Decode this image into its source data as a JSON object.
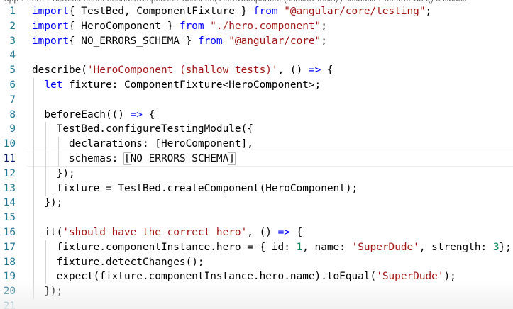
{
  "breadcrumb": {
    "items": [
      "app",
      "hero",
      "hero.component.shallow.spec.ts",
      "describe('HeroComponent (shallow tests)') callback",
      "beforeEach() callback"
    ]
  },
  "editor": {
    "lines": [
      {
        "n": "1",
        "tokens": [
          [
            "kw",
            "import"
          ],
          [
            "",
            "{ TestBed, ComponentFixture } "
          ],
          [
            "kw",
            "from"
          ],
          [
            "",
            " "
          ],
          [
            "str",
            "\"@angular/core/testing\""
          ],
          [
            "",
            ";"
          ]
        ]
      },
      {
        "n": "2",
        "tokens": [
          [
            "kw",
            "import"
          ],
          [
            "",
            "{ HeroComponent } "
          ],
          [
            "kw",
            "from"
          ],
          [
            "",
            " "
          ],
          [
            "str",
            "\"./hero.component\""
          ],
          [
            "",
            ";"
          ]
        ]
      },
      {
        "n": "3",
        "tokens": [
          [
            "kw",
            "import"
          ],
          [
            "",
            "{ NO_ERRORS_SCHEMA } "
          ],
          [
            "kw",
            "from"
          ],
          [
            "",
            " "
          ],
          [
            "str",
            "\"@angular/core\""
          ],
          [
            "",
            ";"
          ]
        ]
      },
      {
        "n": "4",
        "tokens": []
      },
      {
        "n": "5",
        "tokens": [
          [
            "",
            "describe("
          ],
          [
            "str",
            "'HeroComponent (shallow tests)'"
          ],
          [
            "",
            ", () "
          ],
          [
            "kw",
            "=>"
          ],
          [
            "",
            " {"
          ]
        ]
      },
      {
        "n": "6",
        "tokens": [
          [
            "",
            "  "
          ],
          [
            "kw",
            "let"
          ],
          [
            "",
            " fixture: ComponentFixture<HeroComponent>;"
          ]
        ]
      },
      {
        "n": "7",
        "tokens": []
      },
      {
        "n": "8",
        "tokens": [
          [
            "",
            "  beforeEach(() "
          ],
          [
            "kw",
            "=>"
          ],
          [
            "",
            " {"
          ]
        ]
      },
      {
        "n": "9",
        "tokens": [
          [
            "",
            "    TestBed.configureTestingModule({"
          ]
        ]
      },
      {
        "n": "10",
        "tokens": [
          [
            "",
            "      declarations: [HeroComponent],"
          ]
        ]
      },
      {
        "n": "11",
        "tokens": [
          [
            "",
            "      schemas: "
          ],
          [
            "bracket",
            "["
          ],
          [
            "",
            "NO_ERRORS_SCHEMA"
          ],
          [
            "bracket",
            "]"
          ]
        ],
        "current": true
      },
      {
        "n": "12",
        "tokens": [
          [
            "",
            "    });"
          ]
        ]
      },
      {
        "n": "13",
        "tokens": [
          [
            "",
            "    fixture = TestBed.createComponent(HeroComponent);"
          ]
        ]
      },
      {
        "n": "14",
        "tokens": [
          [
            "",
            "  });"
          ]
        ]
      },
      {
        "n": "15",
        "tokens": []
      },
      {
        "n": "16",
        "tokens": [
          [
            "",
            "  it("
          ],
          [
            "str",
            "'should have the correct hero'"
          ],
          [
            "",
            ", () "
          ],
          [
            "kw",
            "=>"
          ],
          [
            "",
            " {"
          ]
        ]
      },
      {
        "n": "17",
        "tokens": [
          [
            "",
            "    fixture.componentInstance.hero = { id: "
          ],
          [
            "num",
            "1"
          ],
          [
            "",
            ", name: "
          ],
          [
            "str",
            "'SuperDude'"
          ],
          [
            "",
            ", strength: "
          ],
          [
            "num",
            "3"
          ],
          [
            "",
            "};"
          ]
        ]
      },
      {
        "n": "18",
        "tokens": [
          [
            "",
            "    fixture.detectChanges();"
          ]
        ]
      },
      {
        "n": "19",
        "tokens": [
          [
            "",
            "    expect(fixture.componentInstance.hero.name).toEqual("
          ],
          [
            "str",
            "'SuperDude'"
          ],
          [
            "",
            ");"
          ]
        ]
      },
      {
        "n": "20",
        "tokens": [
          [
            "",
            "  });"
          ]
        ]
      },
      {
        "n": "21",
        "tokens": []
      }
    ]
  }
}
